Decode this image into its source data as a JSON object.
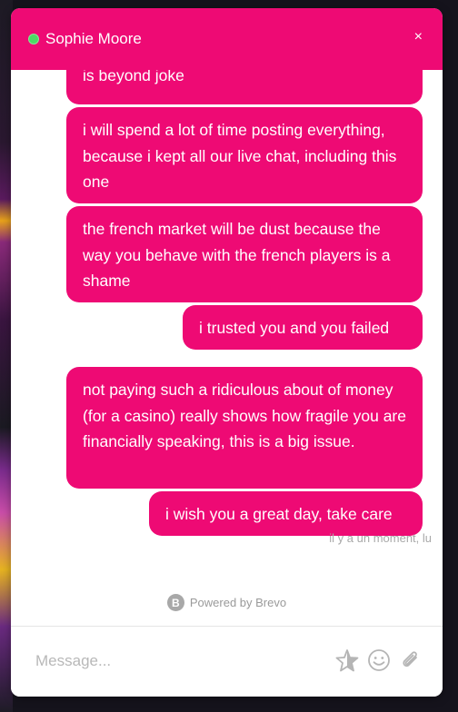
{
  "header": {
    "agent_name": "Sophie Moore",
    "status_color": "#4cd964",
    "close_symbol": "×"
  },
  "messages": [
    {
      "text": "is beyond joke"
    },
    {
      "text": "i will spend a lot of time posting everything, because i kept all our live chat, including this one"
    },
    {
      "text": "the french market will be dust because the way you behave with the french players is a shame"
    },
    {
      "text": "i trusted you and you failed"
    },
    {
      "text": "not paying such a ridiculous about of money (for a casino) really shows how fragile you are financially speaking, this is a big issue."
    },
    {
      "text": "i wish you a great day, take care"
    }
  ],
  "timestamp": "il y a un moment, lu",
  "footer": {
    "logo_letter": "B",
    "powered_by": "Powered by Brevo"
  },
  "composer": {
    "placeholder": "Message...",
    "icons": [
      "star-icon",
      "emoji-icon",
      "paperclip-icon"
    ]
  },
  "theme": {
    "accent": "#ee0a74"
  }
}
